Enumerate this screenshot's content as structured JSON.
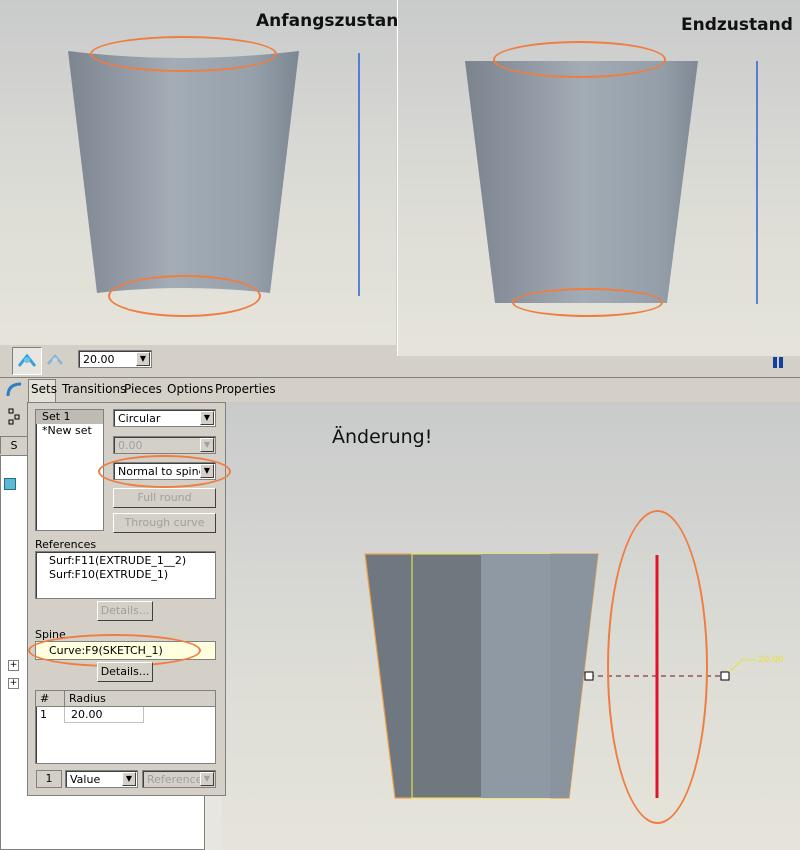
{
  "top_left": {
    "heading": "Anfangszustand"
  },
  "top_right": {
    "heading": "Endzustand"
  },
  "toolbar": {
    "value": "20.00"
  },
  "tabs": [
    "Sets",
    "Transitions",
    "Pieces",
    "Options",
    "Properties"
  ],
  "tabs_extra": {
    "left_tab_partial": "S"
  },
  "set_panel": {
    "sets": [
      "Set 1",
      "*New set"
    ],
    "shape_type": "Circular",
    "disabled_value": "0.00",
    "orientation": "Normal to spine",
    "full_round_label": "Full round",
    "through_curve_label": "Through curve",
    "references_label": "References",
    "references": [
      "Surf:F11(EXTRUDE_1__2)",
      "Surf:F10(EXTRUDE_1)"
    ],
    "details_label": "Details...",
    "spine_label": "Spine",
    "spine_value": "Curve:F9(SKETCH_1)",
    "table_headers": [
      "#",
      "Radius"
    ],
    "table_rows": [
      {
        "n": "1",
        "radius": "20.00"
      }
    ],
    "bottom_index": "1",
    "bottom_mode": "Value",
    "bottom_reference": "Reference"
  },
  "bottom_view": {
    "annotation": "Änderung!",
    "dimension": "20.00"
  },
  "colors": {
    "highlight_orange": "#f07d40",
    "spine_red": "#e0132a",
    "axis_blue": "#2a63d6"
  }
}
